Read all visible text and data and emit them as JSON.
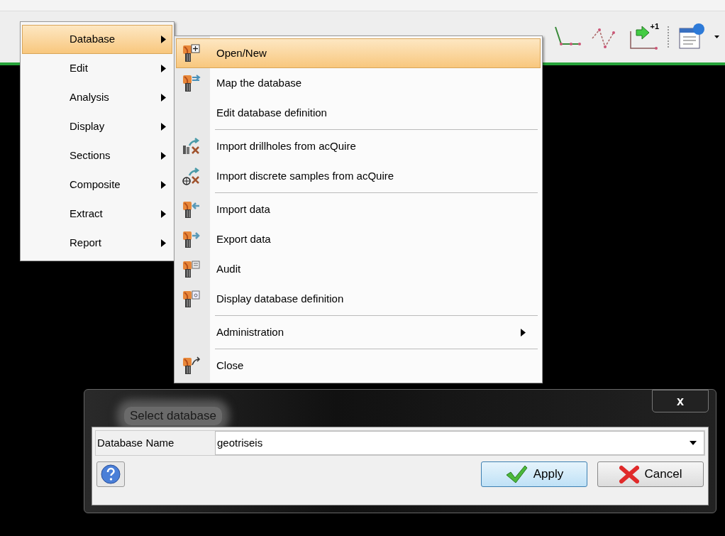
{
  "main_menu": {
    "items": [
      {
        "label": "Database",
        "submenu": true,
        "selected": true
      },
      {
        "label": "Edit",
        "submenu": true,
        "selected": false
      },
      {
        "label": "Analysis",
        "submenu": true,
        "selected": false
      },
      {
        "label": "Display",
        "submenu": true,
        "selected": false
      },
      {
        "label": "Sections",
        "submenu": true,
        "selected": false
      },
      {
        "label": "Composite",
        "submenu": true,
        "selected": false
      },
      {
        "label": "Extract",
        "submenu": true,
        "selected": false
      },
      {
        "label": "Report",
        "submenu": true,
        "selected": false
      }
    ]
  },
  "database_menu": {
    "items": [
      {
        "kind": "item",
        "label": "Open/New",
        "submenu": false,
        "selected": true
      },
      {
        "kind": "item",
        "label": "Map the database",
        "submenu": false,
        "selected": false
      },
      {
        "kind": "item",
        "label": "Edit database definition",
        "submenu": false,
        "selected": false
      },
      {
        "kind": "separator"
      },
      {
        "kind": "item",
        "label": "Import drillholes from acQuire",
        "submenu": false,
        "selected": false
      },
      {
        "kind": "item",
        "label": "Import discrete samples from acQuire",
        "submenu": false,
        "selected": false
      },
      {
        "kind": "separator"
      },
      {
        "kind": "item",
        "label": "Import data",
        "submenu": false,
        "selected": false
      },
      {
        "kind": "item",
        "label": "Export data",
        "submenu": false,
        "selected": false
      },
      {
        "kind": "item",
        "label": "Audit",
        "submenu": false,
        "selected": false
      },
      {
        "kind": "item",
        "label": "Display database definition",
        "submenu": false,
        "selected": false
      },
      {
        "kind": "separator"
      },
      {
        "kind": "item",
        "label": "Administration",
        "submenu": true,
        "selected": false
      },
      {
        "kind": "separator"
      },
      {
        "kind": "item",
        "label": "Close",
        "submenu": false,
        "selected": false
      }
    ]
  },
  "toolbar": {
    "badge": "+1"
  },
  "dialog": {
    "title": "Select database",
    "close": "x",
    "database_name": {
      "label": "Database Name",
      "value": "geotriseis"
    },
    "buttons": [
      {
        "kind": "apply",
        "label": "Apply"
      },
      {
        "kind": "cancel",
        "label": "Cancel"
      }
    ]
  }
}
